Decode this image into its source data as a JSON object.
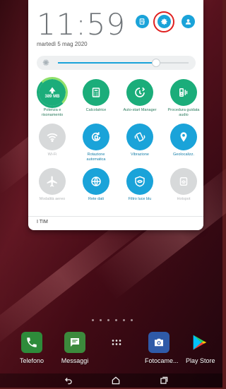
{
  "status": {
    "time": "11:59",
    "date": "martedì 5 mag 2020",
    "operator": "I TIM"
  },
  "header_icons": [
    {
      "name": "notes-icon"
    },
    {
      "name": "settings-icon",
      "highlighted": true
    },
    {
      "name": "user-account-icon"
    }
  ],
  "brightness": {
    "level_fraction": 0.75,
    "icon": "brightness-icon"
  },
  "tiles": [
    {
      "label": "Potenza e\nrisonamento",
      "sub": "389 MB",
      "icon": "boost-icon",
      "state": "green"
    },
    {
      "label": "Calcolatrice",
      "icon": "calculator-icon",
      "state": "green"
    },
    {
      "label": "Auto-start Manager",
      "icon": "autostart-icon",
      "state": "green"
    },
    {
      "label": "Procedura guidata\naudio",
      "icon": "audio-wizard-icon",
      "state": "green"
    },
    {
      "label": "Wi-Fi",
      "icon": "wifi-icon",
      "state": "off"
    },
    {
      "label": "Rotazione\nautomatica",
      "icon": "auto-rotate-icon",
      "state": "blue"
    },
    {
      "label": "Vibrazione",
      "icon": "vibration-icon",
      "state": "blue"
    },
    {
      "label": "Geolocalizz.",
      "icon": "location-icon",
      "state": "blue"
    },
    {
      "label": "Modalità aereo",
      "icon": "airplane-icon",
      "state": "off"
    },
    {
      "label": "Rete dati",
      "icon": "mobile-data-icon",
      "state": "blue"
    },
    {
      "label": "Filtro luce blu",
      "icon": "blue-light-filter-icon",
      "state": "blue"
    },
    {
      "label": "Hotspot",
      "icon": "hotspot-icon",
      "state": "off"
    }
  ],
  "dock": [
    {
      "label": "Telefono",
      "icon": "phone-icon",
      "color": "#2e8b3a"
    },
    {
      "label": "Messaggi",
      "icon": "messages-icon",
      "color": "#3c8a3c"
    },
    {
      "label": "",
      "icon": "app-drawer-icon",
      "color": ""
    },
    {
      "label": "Fotocame...",
      "icon": "camera-icon",
      "color": "#2f5aa8"
    },
    {
      "label": "Play Store",
      "icon": "play-store-icon",
      "color": ""
    }
  ],
  "colors": {
    "accent": "#1aa3d9",
    "green": "#1bad7a",
    "highlight": "#e02020"
  }
}
